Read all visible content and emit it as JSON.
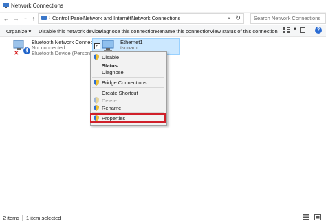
{
  "window": {
    "title": "Network Connections",
    "app_icon": "network-connections-icon"
  },
  "address_bar": {
    "breadcrumbs": [
      "Control Panel",
      "Network and Internet",
      "Network Connections"
    ],
    "search_placeholder": "Search Network Connections"
  },
  "command_bar": {
    "items": [
      "Organize",
      "Disable this network device",
      "Diagnose this connection",
      "Rename this connection",
      "View status of this connection"
    ],
    "organize_caret": "▾"
  },
  "connections": [
    {
      "name": "Bluetooth Network Connection",
      "status": "Not connected",
      "device": "Bluetooth Device (Personal Ar...",
      "icon": "bluetooth-adapter-icon"
    },
    {
      "name": "Ethernet1",
      "status": "tsunami",
      "device": "",
      "icon": "ethernet-adapter-icon",
      "selected": true
    }
  ],
  "context_menu": {
    "items": [
      {
        "label": "Disable",
        "shield": true
      },
      {
        "label": "Status",
        "bold": true
      },
      {
        "label": "Diagnose"
      },
      {
        "label": "Bridge Connections",
        "shield": true
      },
      {
        "label": "Create Shortcut"
      },
      {
        "label": "Delete",
        "shield": true,
        "disabled": true
      },
      {
        "label": "Rename",
        "shield": true
      },
      {
        "label": "Properties",
        "shield": true,
        "highlighted": true
      }
    ]
  },
  "status_bar": {
    "item_count": "2 items",
    "selection": "1 item selected"
  },
  "colors": {
    "selection": "#cce8ff",
    "highlight_box": "#d0202a",
    "accent": "#2b6cd3"
  }
}
